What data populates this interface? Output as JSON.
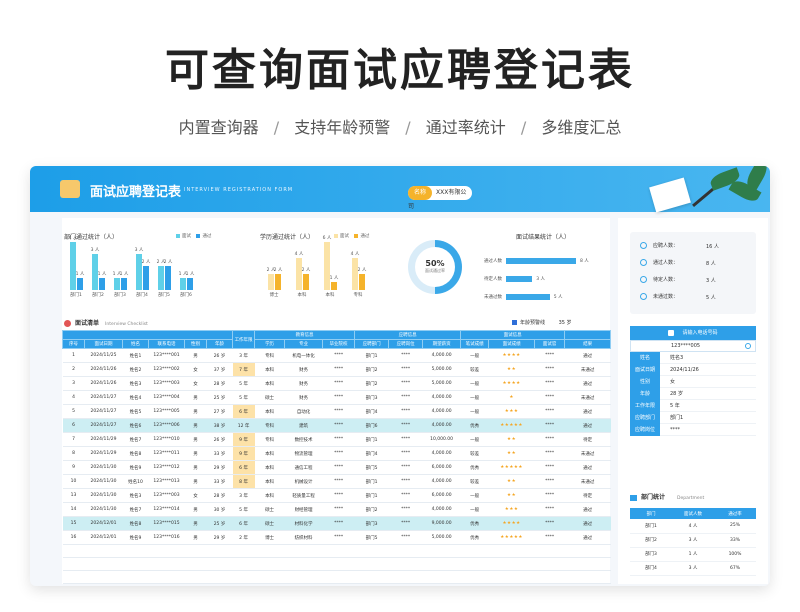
{
  "hero": {
    "title": "可查询面试应聘登记表",
    "features": [
      "内置查询器",
      "支持年龄预警",
      "通过率统计",
      "多维度汇总"
    ],
    "separator": "/"
  },
  "sheet": {
    "title": "面试应聘登记表",
    "subtitle": "INTERVIEW REGISTRATION FORM",
    "company_tag": "名称",
    "company": "XXX有限公司"
  },
  "colors": {
    "accent": "#2e9fe8",
    "cyan_bar": "#5fd0e8",
    "blue_bar": "#2e9fe8",
    "gold": "#f5b32b",
    "pale_gold": "#fbe3a6",
    "highlight_row": "#cdeef3",
    "star": "#f5a623"
  },
  "dept_chart": {
    "title": "部门通过统计（人）",
    "legend": [
      "面试",
      "通过"
    ],
    "categories": [
      "部门1",
      "部门2",
      "部门3",
      "部门4",
      "部门5",
      "部门6"
    ],
    "interview": [
      4,
      3,
      1,
      3,
      2,
      1
    ],
    "passed": [
      1,
      1,
      1,
      2,
      2,
      1
    ],
    "interview_labels": [
      "4 人",
      "3 人",
      "1 人",
      "3 人",
      "2 人",
      "1 人"
    ],
    "passed_labels": [
      "1 人",
      "1 人",
      "1 人",
      "2 人",
      "2 人",
      "1 人"
    ],
    "ymax": 4
  },
  "edu_chart": {
    "title": "学历通过统计（人）",
    "legend": [
      "面试",
      "通过"
    ],
    "categories": [
      "博士",
      "本科",
      "本科",
      "专科"
    ],
    "interview": [
      2,
      4,
      6,
      4
    ],
    "passed": [
      2,
      2,
      1,
      2
    ],
    "interview_labels": [
      "2 人",
      "4 人",
      "6 人",
      "4 人"
    ],
    "passed_labels": [
      "2 人",
      "2 人",
      "1 人",
      "2 人"
    ],
    "ymax": 6
  },
  "pass_rate": {
    "value": "50%",
    "label": "面试通过率",
    "fraction": 0.5
  },
  "result_chart": {
    "title": "面试结果统计（人）",
    "rows": [
      {
        "label": "通过人数",
        "value": 8,
        "text": "8 人"
      },
      {
        "label": "待定人数",
        "value": 3,
        "text": "3 人"
      },
      {
        "label": "未通过数",
        "value": 5,
        "text": "5 人"
      }
    ],
    "max": 8
  },
  "list": {
    "title": "面试清单",
    "subtitle": "Interview Checklist",
    "warning_label": "年龄预警线",
    "warning_value": "35 岁",
    "group_headers": [
      "工作年限",
      "教育信息",
      "应聘信息",
      "面试信息"
    ],
    "headers": [
      "序号",
      "面试日期",
      "姓名",
      "联系电话",
      "性别",
      "年龄",
      "工作年限",
      "学历",
      "专业",
      "毕业院校",
      "应聘部门",
      "应聘岗位",
      "期望薪资",
      "笔试成绩",
      "面试成绩",
      "面试官",
      "结果"
    ],
    "rows": [
      [
        "1",
        "2024/11/25",
        "姓名1",
        "123****001",
        "男",
        "26 岁",
        "3 年",
        "专科",
        "机电一体化",
        "****",
        "部门1",
        "****",
        "4,000.00",
        "一般",
        "★★★★",
        "****",
        "通过"
      ],
      [
        "2",
        "2024/11/26",
        "姓名2",
        "123****002",
        "女",
        "37 岁",
        "7 年",
        "本科",
        "财务",
        "****",
        "部门2",
        "****",
        "5,000.00",
        "较差",
        "★★",
        "****",
        "未通过"
      ],
      [
        "3",
        "2024/11/26",
        "姓名3",
        "123****003",
        "女",
        "28 岁",
        "5 年",
        "本科",
        "财务",
        "****",
        "部门2",
        "****",
        "5,000.00",
        "一般",
        "★★★★",
        "****",
        "通过"
      ],
      [
        "4",
        "2024/11/27",
        "姓名4",
        "123****004",
        "男",
        "25 岁",
        "5 年",
        "硕士",
        "财务",
        "****",
        "部门3",
        "****",
        "4,000.00",
        "一般",
        "★",
        "****",
        "未通过"
      ],
      [
        "5",
        "2024/11/27",
        "姓名5",
        "123****005",
        "男",
        "27 岁",
        "6 年",
        "本科",
        "自动化",
        "****",
        "部门4",
        "****",
        "4,000.00",
        "一般",
        "★★★",
        "****",
        "通过"
      ],
      [
        "6",
        "2024/11/27",
        "姓名6",
        "123****006",
        "男",
        "38 岁",
        "12 年",
        "专科",
        "建筑",
        "****",
        "部门6",
        "****",
        "4,000.00",
        "优秀",
        "★★★★★",
        "****",
        "通过"
      ],
      [
        "7",
        "2024/11/29",
        "姓名7",
        "123****010",
        "男",
        "26 岁",
        "9 年",
        "专科",
        "数控技术",
        "****",
        "部门1",
        "****",
        "10,000.00",
        "一般",
        "★★",
        "****",
        "待定"
      ],
      [
        "8",
        "2024/11/29",
        "姓名8",
        "123****011",
        "男",
        "33 岁",
        "9 年",
        "本科",
        "物流管理",
        "****",
        "部门4",
        "****",
        "4,000.00",
        "较差",
        "★★",
        "****",
        "未通过"
      ],
      [
        "9",
        "2024/11/30",
        "姓名9",
        "123****012",
        "男",
        "29 岁",
        "6 年",
        "本科",
        "通信工程",
        "****",
        "部门5",
        "****",
        "6,000.00",
        "优秀",
        "★★★★★",
        "****",
        "通过"
      ],
      [
        "10",
        "2024/11/30",
        "姓名10",
        "123****013",
        "男",
        "33 岁",
        "8 年",
        "本科",
        "机械设计",
        "****",
        "部门1",
        "****",
        "4,000.00",
        "较差",
        "★★",
        "****",
        "未通过"
      ],
      [
        "13",
        "2024/11/30",
        "姓名3",
        "123****003",
        "女",
        "28 岁",
        "3 年",
        "本科",
        "轻质量工程",
        "****",
        "部门1",
        "****",
        "6,000.00",
        "一般",
        "★★",
        "****",
        "待定"
      ],
      [
        "14",
        "2024/11/30",
        "姓名7",
        "123****014",
        "男",
        "30 岁",
        "5 年",
        "硕士",
        "财经管理",
        "****",
        "部门2",
        "****",
        "4,000.00",
        "一般",
        "★★★",
        "****",
        "通过"
      ],
      [
        "15",
        "2024/12/01",
        "姓名8",
        "123****015",
        "男",
        "25 岁",
        "6 年",
        "硕士",
        "材料化学",
        "****",
        "部门3",
        "****",
        "9,000.00",
        "优秀",
        "★★★★",
        "****",
        "通过"
      ],
      [
        "16",
        "2024/12/01",
        "姓名9",
        "123****016",
        "男",
        "29 岁",
        "2 年",
        "博士",
        "纺织材料",
        "****",
        "部门5",
        "****",
        "5,000.00",
        "优秀",
        "★★★★★",
        "****",
        "通过"
      ]
    ]
  },
  "stats": {
    "rows": [
      {
        "label": "应聘人数：",
        "value": "16 人"
      },
      {
        "label": "通过人数：",
        "value": "8 人"
      },
      {
        "label": "待定人数：",
        "value": "3 人"
      },
      {
        "label": "未通过数：",
        "value": "5 人"
      }
    ]
  },
  "query": {
    "title": "请输入电话号码",
    "input_value": "123****005",
    "fields": [
      {
        "key": "姓名",
        "value": "姓名3"
      },
      {
        "key": "面试日期",
        "value": "2024/11/26"
      },
      {
        "key": "性别",
        "value": "女"
      },
      {
        "key": "年龄",
        "value": "28 岁"
      },
      {
        "key": "工作年限",
        "value": "5 年"
      },
      {
        "key": "应聘部门",
        "value": "部门1"
      },
      {
        "key": "应聘岗位",
        "value": "****"
      }
    ]
  },
  "dept_stats": {
    "title": "部门统计",
    "subtitle": "Department",
    "headers": [
      "部门",
      "面试人数",
      "通过率"
    ],
    "rows": [
      [
        "部门1",
        "4 人",
        "25%"
      ],
      [
        "部门2",
        "3 人",
        "33%"
      ],
      [
        "部门3",
        "1 人",
        "100%"
      ],
      [
        "部门4",
        "3 人",
        "67%"
      ]
    ]
  }
}
